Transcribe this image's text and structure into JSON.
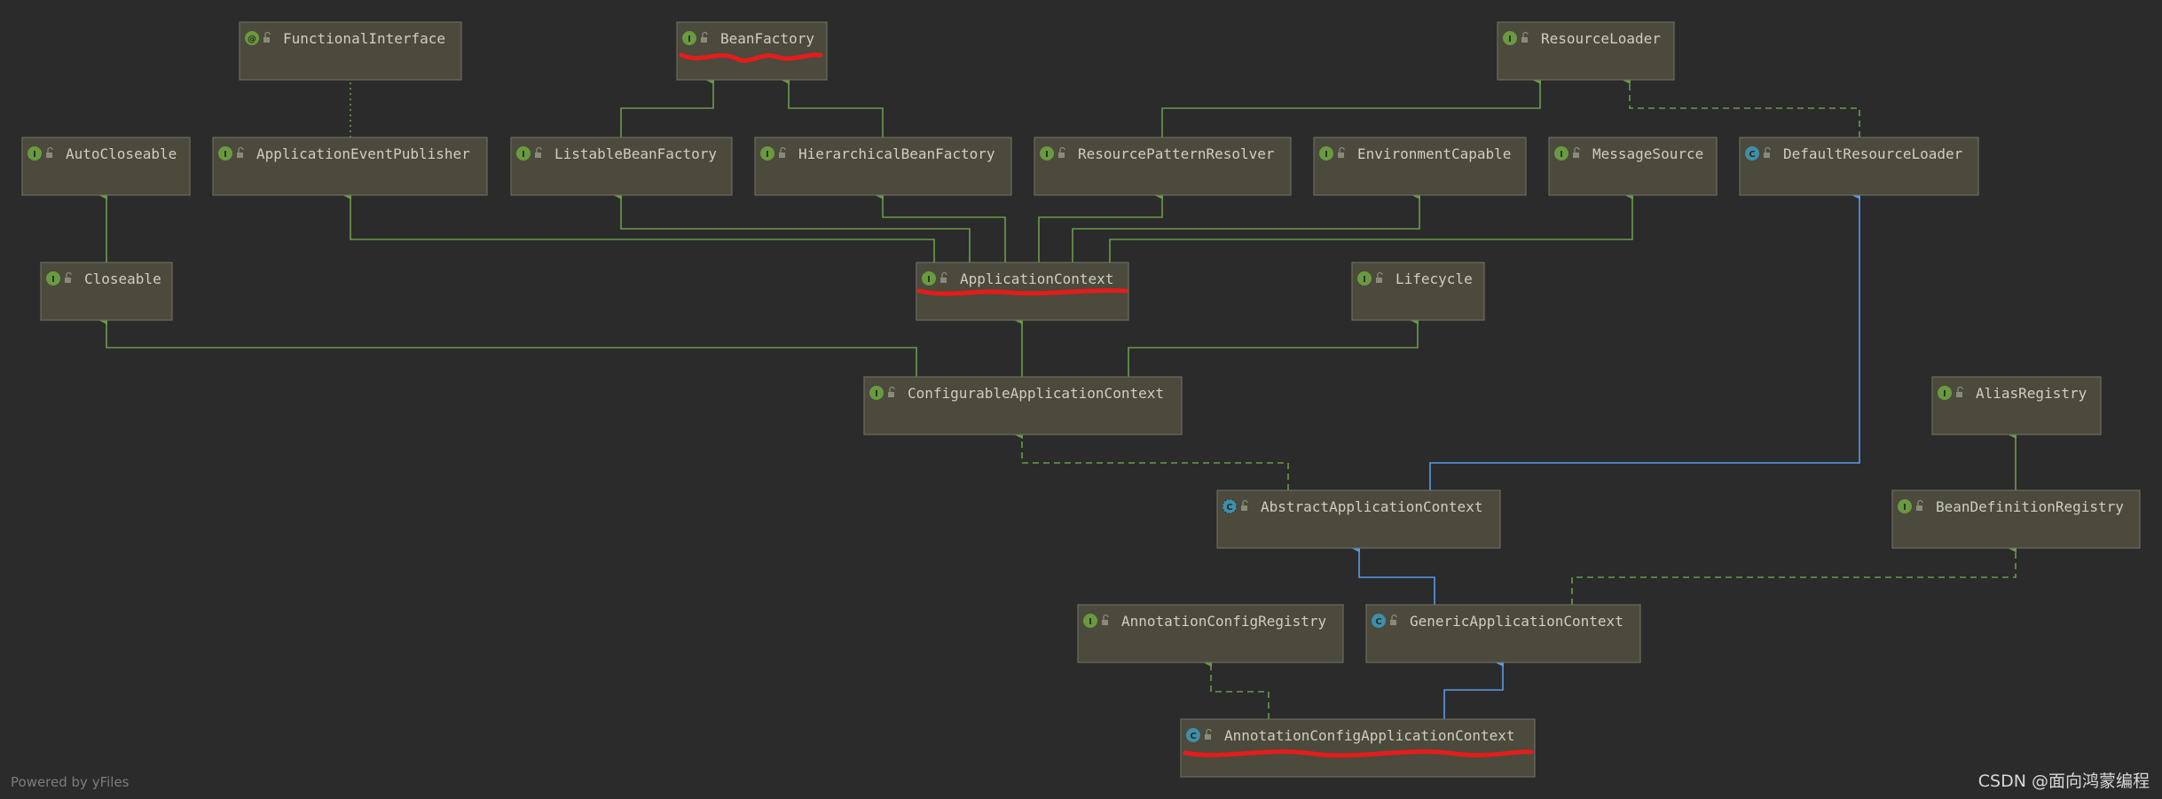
{
  "colors": {
    "interface_badge": "#6a9a3f",
    "class_badge": "#3f8fa8",
    "extends_edge": "#6a9a4a",
    "class_edge": "#5a9ae8",
    "highlight": "#e51c1c"
  },
  "nodes": [
    {
      "id": "functional-interface",
      "label": "FunctionalInterface",
      "kind": "annotation",
      "badge": "@"
    },
    {
      "id": "bean-factory",
      "label": "BeanFactory",
      "kind": "interface",
      "badge": "I",
      "highlighted": true
    },
    {
      "id": "resource-loader",
      "label": "ResourceLoader",
      "kind": "interface",
      "badge": "I"
    },
    {
      "id": "auto-closeable",
      "label": "AutoCloseable",
      "kind": "interface",
      "badge": "I"
    },
    {
      "id": "application-event-publisher",
      "label": "ApplicationEventPublisher",
      "kind": "interface",
      "badge": "I"
    },
    {
      "id": "listable-bean-factory",
      "label": "ListableBeanFactory",
      "kind": "interface",
      "badge": "I"
    },
    {
      "id": "hierarchical-bean-factory",
      "label": "HierarchicalBeanFactory",
      "kind": "interface",
      "badge": "I"
    },
    {
      "id": "resource-pattern-resolver",
      "label": "ResourcePatternResolver",
      "kind": "interface",
      "badge": "I"
    },
    {
      "id": "environment-capable",
      "label": "EnvironmentCapable",
      "kind": "interface",
      "badge": "I"
    },
    {
      "id": "message-source",
      "label": "MessageSource",
      "kind": "interface",
      "badge": "I"
    },
    {
      "id": "default-resource-loader",
      "label": "DefaultResourceLoader",
      "kind": "class",
      "badge": "C"
    },
    {
      "id": "closeable",
      "label": "Closeable",
      "kind": "interface",
      "badge": "I"
    },
    {
      "id": "application-context",
      "label": "ApplicationContext",
      "kind": "interface",
      "badge": "I",
      "highlighted": true
    },
    {
      "id": "lifecycle",
      "label": "Lifecycle",
      "kind": "interface",
      "badge": "I"
    },
    {
      "id": "configurable-application-context",
      "label": "ConfigurableApplicationContext",
      "kind": "interface",
      "badge": "I"
    },
    {
      "id": "alias-registry",
      "label": "AliasRegistry",
      "kind": "interface",
      "badge": "I"
    },
    {
      "id": "abstract-application-context",
      "label": "AbstractApplicationContext",
      "kind": "abstract",
      "badge": "C"
    },
    {
      "id": "bean-definition-registry",
      "label": "BeanDefinitionRegistry",
      "kind": "interface",
      "badge": "I"
    },
    {
      "id": "annotation-config-registry",
      "label": "AnnotationConfigRegistry",
      "kind": "interface",
      "badge": "I"
    },
    {
      "id": "generic-application-context",
      "label": "GenericApplicationContext",
      "kind": "class",
      "badge": "C"
    },
    {
      "id": "annotation-config-application-context",
      "label": "AnnotationConfigApplicationContext",
      "kind": "class",
      "badge": "C",
      "highlighted": true
    }
  ],
  "edges": [
    {
      "from": "listable-bean-factory",
      "to": "bean-factory",
      "style": "extends"
    },
    {
      "from": "hierarchical-bean-factory",
      "to": "bean-factory",
      "style": "extends"
    },
    {
      "from": "resource-pattern-resolver",
      "to": "resource-loader",
      "style": "extends"
    },
    {
      "from": "default-resource-loader",
      "to": "resource-loader",
      "style": "implements"
    },
    {
      "from": "application-event-publisher",
      "to": "functional-interface",
      "style": "annotated"
    },
    {
      "from": "closeable",
      "to": "auto-closeable",
      "style": "extends"
    },
    {
      "from": "application-context",
      "to": "application-event-publisher",
      "style": "extends"
    },
    {
      "from": "application-context",
      "to": "listable-bean-factory",
      "style": "extends"
    },
    {
      "from": "application-context",
      "to": "hierarchical-bean-factory",
      "style": "extends"
    },
    {
      "from": "application-context",
      "to": "resource-pattern-resolver",
      "style": "extends"
    },
    {
      "from": "application-context",
      "to": "environment-capable",
      "style": "extends"
    },
    {
      "from": "application-context",
      "to": "message-source",
      "style": "extends"
    },
    {
      "from": "configurable-application-context",
      "to": "closeable",
      "style": "extends"
    },
    {
      "from": "configurable-application-context",
      "to": "application-context",
      "style": "extends"
    },
    {
      "from": "configurable-application-context",
      "to": "lifecycle",
      "style": "extends"
    },
    {
      "from": "abstract-application-context",
      "to": "configurable-application-context",
      "style": "implements"
    },
    {
      "from": "abstract-application-context",
      "to": "default-resource-loader",
      "style": "class-extends"
    },
    {
      "from": "bean-definition-registry",
      "to": "alias-registry",
      "style": "extends"
    },
    {
      "from": "generic-application-context",
      "to": "abstract-application-context",
      "style": "class-extends"
    },
    {
      "from": "generic-application-context",
      "to": "bean-definition-registry",
      "style": "implements"
    },
    {
      "from": "annotation-config-application-context",
      "to": "annotation-config-registry",
      "style": "implements"
    },
    {
      "from": "annotation-config-application-context",
      "to": "generic-application-context",
      "style": "class-extends"
    }
  ],
  "footer": {
    "powered_by": "Powered by yFiles",
    "watermark": "CSDN @面向鸿蒙编程"
  }
}
